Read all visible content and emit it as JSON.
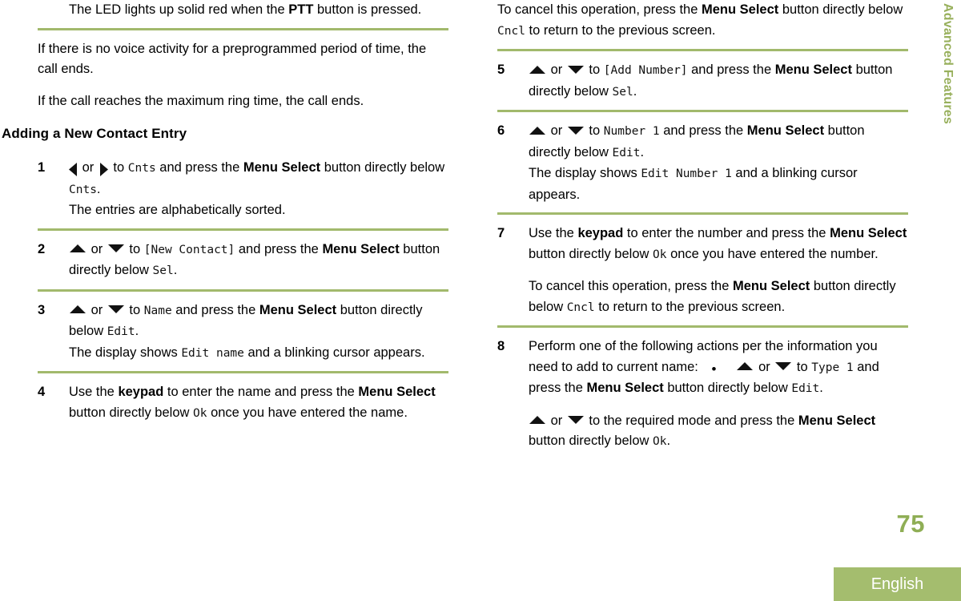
{
  "document": {
    "page_number": "75",
    "language": "English",
    "section_tab": "Advanced Features",
    "accent_color": "#a4bd6e",
    "rule_color": "#a2b96c",
    "page_number_color": "#8fae55"
  },
  "left_column": {
    "intro": {
      "led_note": {
        "pre": "The LED lights up solid red when the ",
        "bold": "PTT",
        "post": " button is pressed."
      },
      "no_voice_activity": "If there is no voice activity for a preprogrammed period of time, the call ends.",
      "max_ring_time": "If the call reaches the maximum ring time, the call ends."
    },
    "heading": "Adding a New Contact Entry",
    "steps": [
      {
        "num": "1",
        "parts": {
          "or": " or ",
          "to": " to ",
          "target": "Cnts",
          "and_press": " and press the ",
          "menu_select": "Menu Select",
          "button_below": " button directly below ",
          "softkey": "Cnts",
          "period": "."
        },
        "result": "The entries are alphabetically sorted."
      },
      {
        "num": "2",
        "parts": {
          "or": " or ",
          "to": " to ",
          "target": "[New Contact]",
          "and_press": " and press the ",
          "menu_select": "Menu Select",
          "button_below": " button directly below ",
          "softkey": "Sel",
          "period": "."
        }
      },
      {
        "num": "3",
        "parts": {
          "or": " or ",
          "to": " to ",
          "target": "Name",
          "and_press": " and press the ",
          "menu_select": "Menu Select",
          "button_below": " button directly below ",
          "softkey": "Edit",
          "period": "."
        },
        "display_line": {
          "pre": "The display shows ",
          "display": "Edit name",
          "post": " and a blinking cursor appears."
        }
      },
      {
        "num": "4",
        "keypad_line": {
          "pre": "Use the ",
          "bold1": "keypad",
          "mid1": " to enter the name and press the ",
          "bold2": "Menu Select",
          "mid2": " button directly below ",
          "softkey": "Ok",
          "post": " once you have entered the name."
        }
      }
    ]
  },
  "right_column": {
    "cancel_note_top": {
      "pre": "To cancel this operation, press the ",
      "bold": "Menu Select",
      "mid": " button directly below ",
      "softkey": "Cncl",
      "post": " to return to the previous screen."
    },
    "steps": [
      {
        "num": "5",
        "parts": {
          "or": " or ",
          "to": " to ",
          "target": "[Add Number]",
          "and_press": " and press the ",
          "menu_select": "Menu Select",
          "button_below": " button directly below ",
          "softkey": "Sel",
          "period": "."
        }
      },
      {
        "num": "6",
        "parts": {
          "or": " or ",
          "to": " to ",
          "target": "Number  1",
          "and_press": " and press the ",
          "menu_select": "Menu Select",
          "button_below": " button directly below ",
          "softkey": "Edit",
          "period": "."
        },
        "display_line": {
          "pre": "The display shows ",
          "display": "Edit Number  1",
          "post": " and a blinking cursor appears."
        }
      },
      {
        "num": "7",
        "keypad_line": {
          "pre": "Use the ",
          "bold1": "keypad",
          "mid1": " to enter the number and press the ",
          "bold2": "Menu Select",
          "mid2": " button directly below ",
          "softkey": "Ok",
          "post": " once you have entered the number."
        },
        "cancel_note": {
          "pre": "To cancel this operation, press the ",
          "bold": "Menu Select",
          "mid": " button directly below ",
          "softkey": "Cncl",
          "post": " to return to the previous screen."
        }
      },
      {
        "num": "8",
        "intro": "Perform one of the following actions per the information you need to add to current name:",
        "bullet": {
          "or": " or ",
          "to": " to ",
          "target": "Type  1",
          "and_press": " and press the ",
          "menu_select": "Menu Select",
          "button_below": " button directly below ",
          "softkey": "Edit",
          "period": "."
        },
        "bullet_cont": {
          "or": " or ",
          "to_mode": " to the required mode and press the ",
          "menu_select": "Menu Select",
          "button_below": " button directly below ",
          "softkey": "Ok",
          "period": "."
        }
      }
    ]
  }
}
